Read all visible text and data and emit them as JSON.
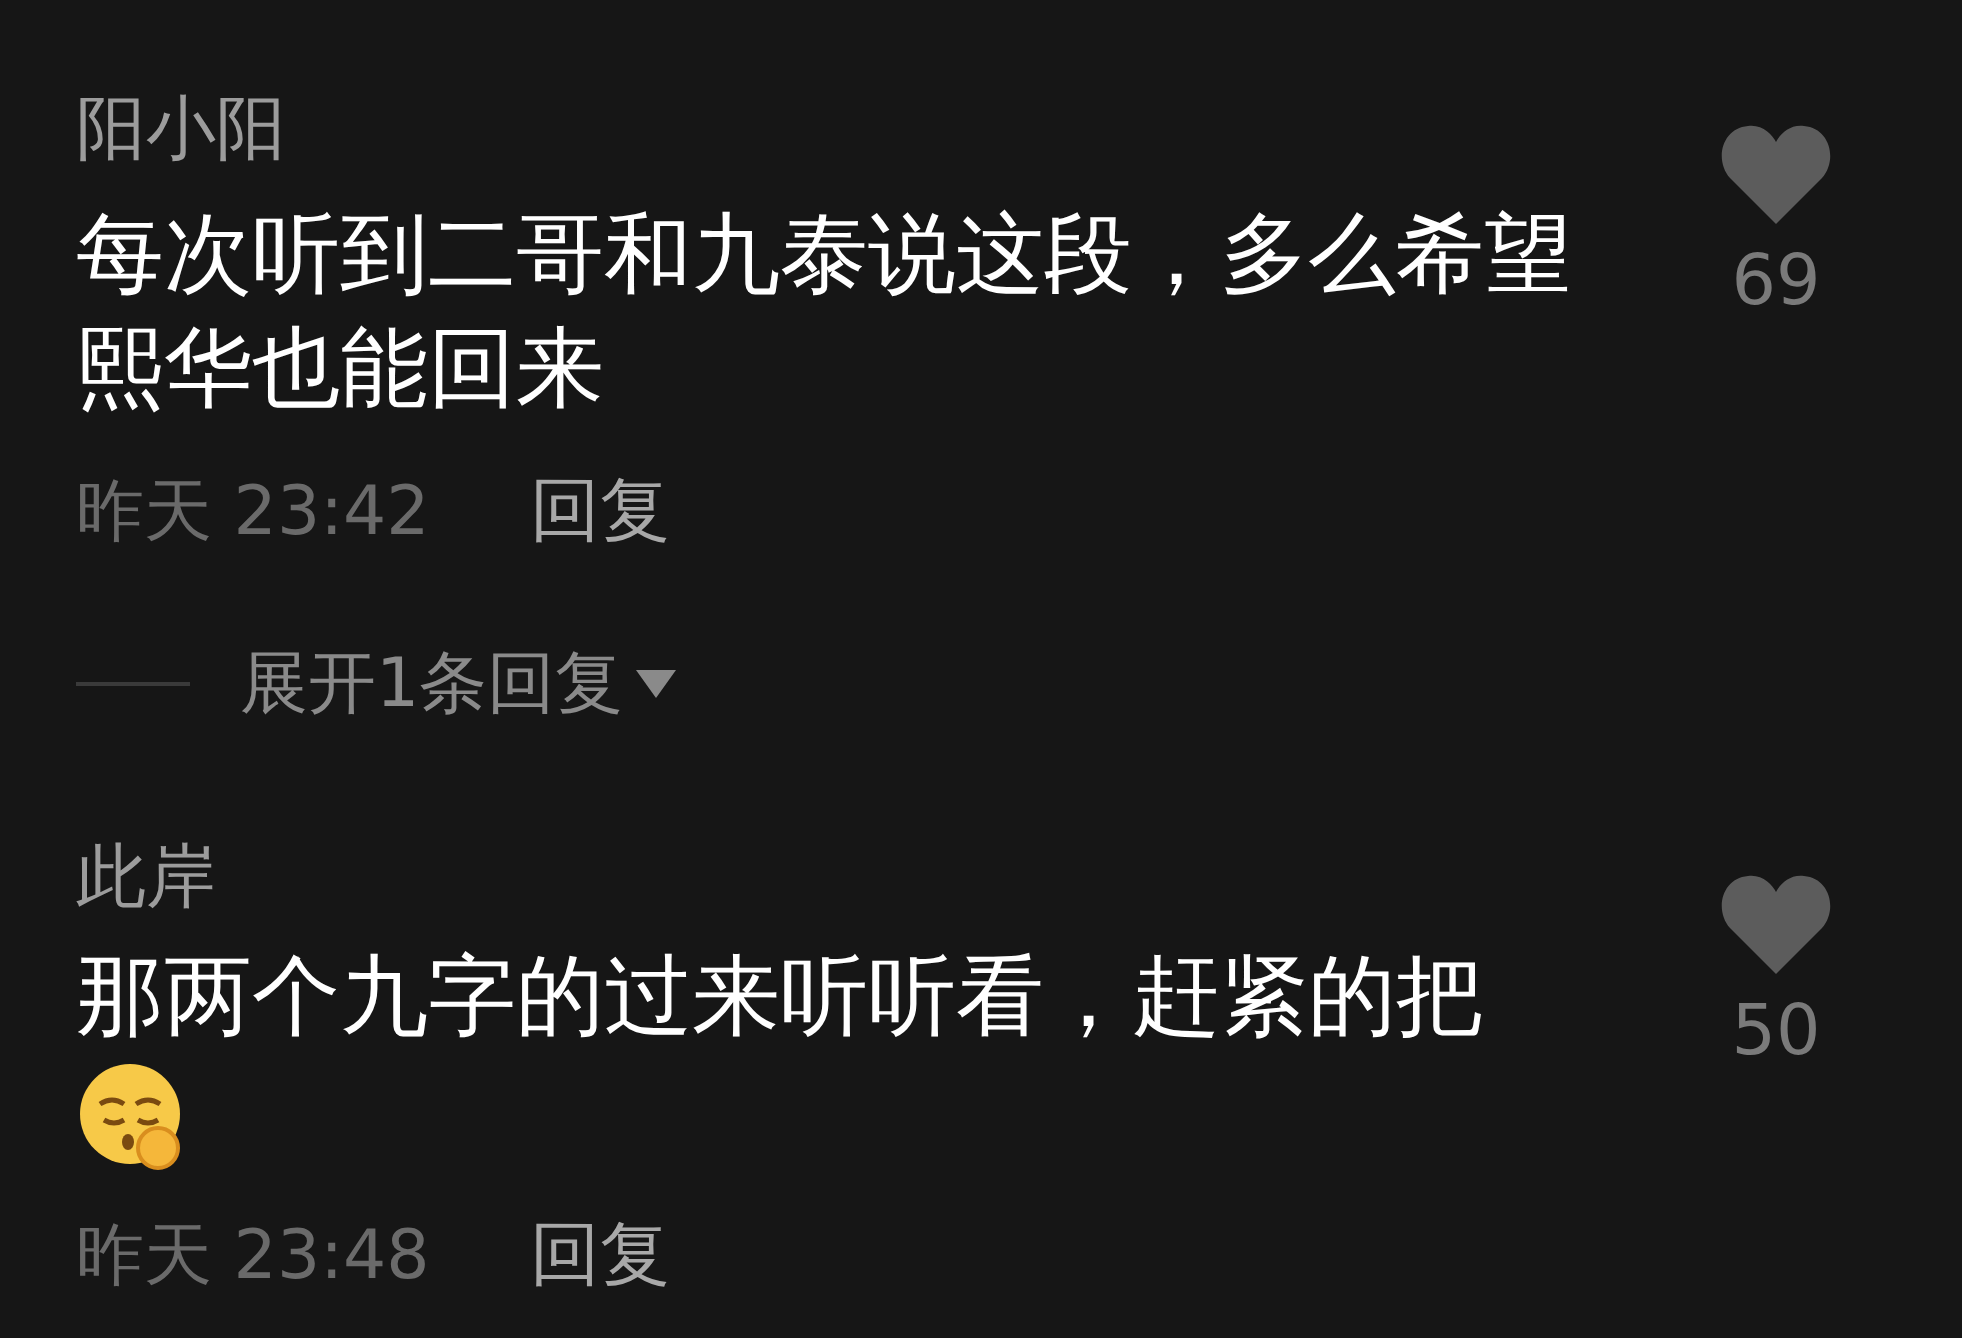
{
  "comments": [
    {
      "name": "阳小阳",
      "text": "每次听到二哥和九泰说这段，多么希望熙华也能回来",
      "emoji": false,
      "time": "昨天 23:42",
      "reply": "回复",
      "liked": false,
      "likes": "69",
      "expand": "展开1条回复"
    },
    {
      "name": "此岸",
      "text": "那两个九字的过来听听看，赶紧的把",
      "emoji": true,
      "time": "昨天 23:48",
      "reply": "回复",
      "liked": false,
      "likes": "50"
    }
  ]
}
